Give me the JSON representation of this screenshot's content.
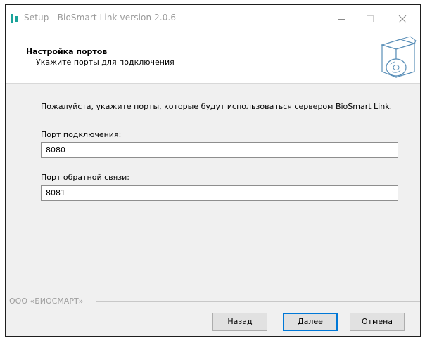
{
  "window": {
    "title": "Setup - BioSmart Link version 2.0.6"
  },
  "header": {
    "title": "Настройка портов",
    "subtitle": "Укажите порты для подключения"
  },
  "body": {
    "description": "Пожалуйста, укажите порты, которые будут использоваться сервером BioSmart Link.",
    "connection_port": {
      "label": "Порт подключения:",
      "value": "8080"
    },
    "callback_port": {
      "label": "Порт обратной связи:",
      "value": "8081"
    }
  },
  "footer": {
    "company": "ООО «БИОСМАРТ»",
    "back_label": "Назад",
    "next_label": "Далее",
    "cancel_label": "Отмена"
  },
  "colors": {
    "accent": "#1aa39a",
    "focus": "#0078d7"
  },
  "icons": [
    "app-icon",
    "minimize-icon",
    "maximize-icon",
    "close-icon",
    "cd-box-icon"
  ]
}
